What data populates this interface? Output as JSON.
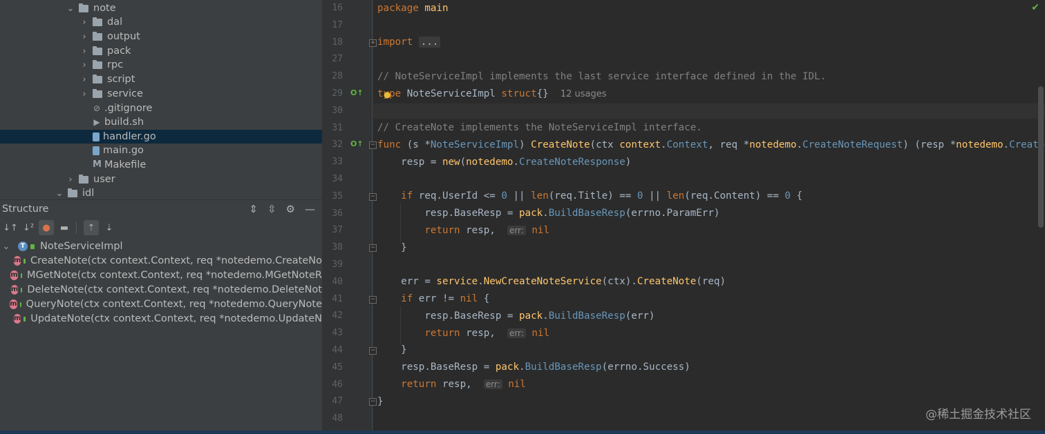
{
  "project_tree": {
    "items": [
      {
        "label": "note",
        "type": "folder",
        "expanded": true,
        "depth": 0
      },
      {
        "label": "dal",
        "type": "folder",
        "expanded": false,
        "depth": 1
      },
      {
        "label": "output",
        "type": "folder",
        "expanded": false,
        "depth": 1
      },
      {
        "label": "pack",
        "type": "folder",
        "expanded": false,
        "depth": 1
      },
      {
        "label": "rpc",
        "type": "folder",
        "expanded": false,
        "depth": 1
      },
      {
        "label": "script",
        "type": "folder",
        "expanded": false,
        "depth": 1
      },
      {
        "label": "service",
        "type": "folder",
        "expanded": false,
        "depth": 1
      },
      {
        "label": ".gitignore",
        "type": "file",
        "depth": 1
      },
      {
        "label": "build.sh",
        "type": "file",
        "depth": 1
      },
      {
        "label": "handler.go",
        "type": "go",
        "depth": 1,
        "selected": true
      },
      {
        "label": "main.go",
        "type": "go",
        "depth": 1
      },
      {
        "label": "Makefile",
        "type": "makefile",
        "depth": 1
      },
      {
        "label": "user",
        "type": "folder",
        "expanded": false,
        "depth": 0
      },
      {
        "label": "idl",
        "type": "folder",
        "expanded": true,
        "depth": -1
      }
    ]
  },
  "structure": {
    "title": "Structure",
    "root": "NoteServiceImpl",
    "methods": [
      "CreateNote(ctx context.Context, req *notedemo.CreateNo",
      "MGetNote(ctx context.Context, req *notedemo.MGetNoteR",
      "DeleteNote(ctx context.Context, req *notedemo.DeleteNot",
      "QueryNote(ctx context.Context, req *notedemo.QueryNote",
      "UpdateNote(ctx context.Context, req *notedemo.UpdateN"
    ]
  },
  "editor": {
    "line_numbers": [
      "16",
      "17",
      "18",
      "27",
      "28",
      "29",
      "30",
      "31",
      "32",
      "33",
      "34",
      "35",
      "36",
      "37",
      "38",
      "39",
      "40",
      "41",
      "42",
      "43",
      "44",
      "45",
      "46",
      "47",
      "48"
    ],
    "usages": "12 usages",
    "err_hint": "err:",
    "fold_placeholder": "..."
  },
  "watermark": "@稀土掘金技术社区",
  "colors": {
    "accent": "#62b543",
    "selection": "#0d293e",
    "background": "#2b2b2b"
  }
}
